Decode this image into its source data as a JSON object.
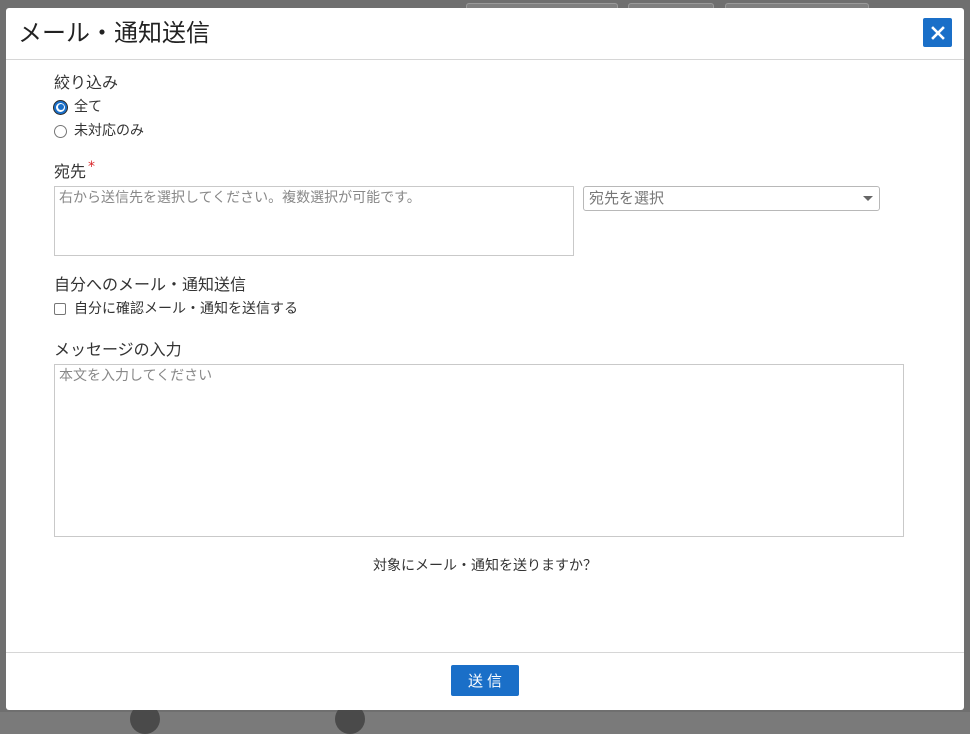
{
  "dialog": {
    "title": "メール・通知送信",
    "close_label": "×"
  },
  "filter": {
    "heading": "絞り込み",
    "options": [
      {
        "label": "全て",
        "checked": true
      },
      {
        "label": "未対応のみ",
        "checked": false
      }
    ]
  },
  "recipients": {
    "heading": "宛先",
    "required_mark": "*",
    "placeholder": "右から送信先を選択してください。複数選択が可能です。",
    "select_placeholder": "宛先を選択"
  },
  "self_send": {
    "heading": "自分へのメール・通知送信",
    "checkbox_label": "自分に確認メール・通知を送信する"
  },
  "message": {
    "heading": "メッセージの入力",
    "placeholder": "本文を入力してください"
  },
  "confirm_text": "対象にメール・通知を送りますか？",
  "footer": {
    "send_label": "送信"
  },
  "colors": {
    "accent": "#1a6fc8",
    "required": "#d9262a"
  }
}
